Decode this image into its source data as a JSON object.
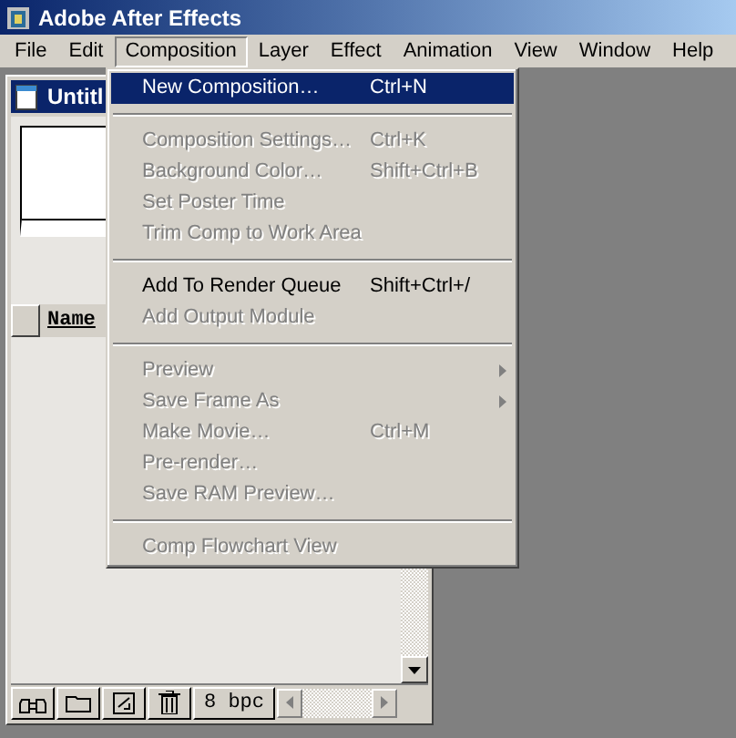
{
  "window": {
    "title": "Adobe After Effects"
  },
  "menu_bar": [
    {
      "label": "File",
      "open": false
    },
    {
      "label": "Edit",
      "open": false
    },
    {
      "label": "Composition",
      "open": true
    },
    {
      "label": "Layer",
      "open": false
    },
    {
      "label": "Effect",
      "open": false
    },
    {
      "label": "Animation",
      "open": false
    },
    {
      "label": "View",
      "open": false
    },
    {
      "label": "Window",
      "open": false
    },
    {
      "label": "Help",
      "open": false
    }
  ],
  "menu": [
    {
      "kind": "item",
      "label": "New Composition…",
      "shortcut": "Ctrl+N",
      "disabled": false,
      "selected": true,
      "submenu": false
    },
    {
      "kind": "separator"
    },
    {
      "kind": "item",
      "label": "Composition Settings…",
      "shortcut": "Ctrl+K",
      "disabled": true,
      "selected": false,
      "submenu": false
    },
    {
      "kind": "item",
      "label": "Background Color…",
      "shortcut": "Shift+Ctrl+B",
      "disabled": true,
      "selected": false,
      "submenu": false
    },
    {
      "kind": "item",
      "label": "Set Poster Time",
      "disabled": true,
      "selected": false,
      "submenu": false
    },
    {
      "kind": "item",
      "label": "Trim Comp to Work Area",
      "disabled": true,
      "selected": false,
      "submenu": false
    },
    {
      "kind": "separator"
    },
    {
      "kind": "item",
      "label": "Add To Render Queue",
      "shortcut": "Shift+Ctrl+/",
      "disabled": false,
      "selected": false,
      "submenu": false
    },
    {
      "kind": "item",
      "label": "Add Output Module",
      "disabled": true,
      "selected": false,
      "submenu": false
    },
    {
      "kind": "separator"
    },
    {
      "kind": "item",
      "label": "Preview",
      "disabled": true,
      "selected": false,
      "submenu": true
    },
    {
      "kind": "item",
      "label": "Save Frame As",
      "disabled": true,
      "selected": false,
      "submenu": true
    },
    {
      "kind": "item",
      "label": "Make Movie…",
      "shortcut": "Ctrl+M",
      "disabled": true,
      "selected": false,
      "submenu": false
    },
    {
      "kind": "item",
      "label": "Pre-render…",
      "disabled": true,
      "selected": false,
      "submenu": false
    },
    {
      "kind": "item",
      "label": "Save RAM Preview…",
      "disabled": true,
      "selected": false,
      "submenu": false
    },
    {
      "kind": "separator"
    },
    {
      "kind": "item",
      "label": "Comp Flowchart View",
      "disabled": true,
      "selected": false,
      "submenu": false
    }
  ],
  "project_window": {
    "title": "Untitl",
    "columns": [
      "Name"
    ],
    "toolbar": {
      "depth_button": "8 bpc"
    }
  }
}
